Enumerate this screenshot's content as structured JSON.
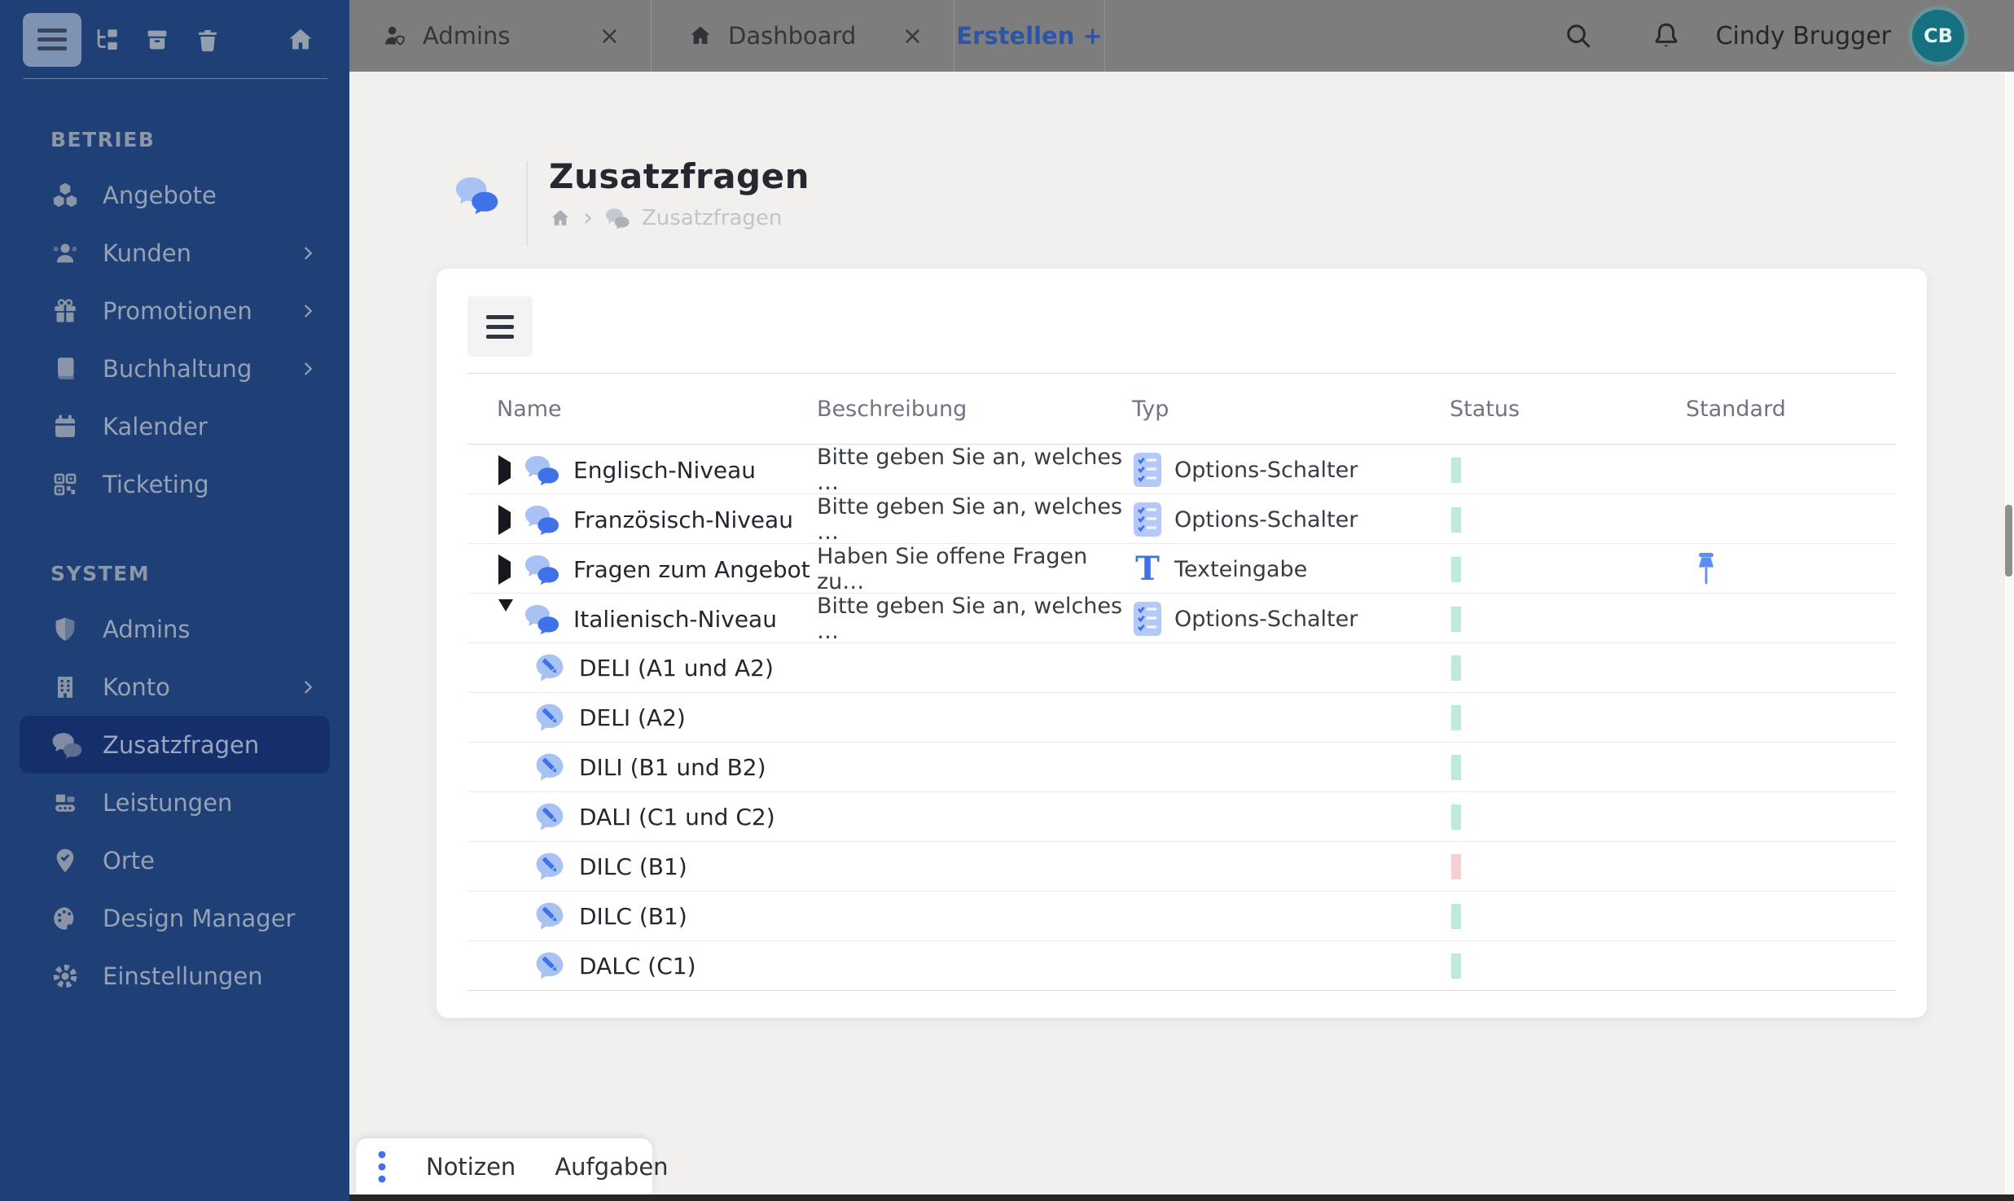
{
  "colors": {
    "sidebar_bg": "#1e4076",
    "sidebar_active_bg": "#152f6a",
    "topbar_bg": "#7d7d7d",
    "accent_blue": "#3f72e8",
    "light_blue": "#a9c2f4",
    "link_blue": "#2d55a5",
    "status_green": "#35bd8d",
    "status_red": "#e25f6a",
    "avatar_teal": "#15707f"
  },
  "sidebar": {
    "toolbar_icons": [
      "menu-icon",
      "tree-icon",
      "archive-icon",
      "trash-icon",
      "home-icon"
    ],
    "sections": [
      {
        "label": "BETRIEB",
        "items": [
          {
            "label": "Angebote",
            "icon": "cubes-icon",
            "chevron": false
          },
          {
            "label": "Kunden",
            "icon": "users-icon",
            "chevron": true
          },
          {
            "label": "Promotionen",
            "icon": "gift-icon",
            "chevron": true
          },
          {
            "label": "Buchhaltung",
            "icon": "book-icon",
            "chevron": true
          },
          {
            "label": "Kalender",
            "icon": "calendar-icon",
            "chevron": false
          },
          {
            "label": "Ticketing",
            "icon": "qr-code-icon",
            "chevron": false
          }
        ]
      },
      {
        "label": "SYSTEM",
        "items": [
          {
            "label": "Admins",
            "icon": "shield-icon",
            "chevron": false
          },
          {
            "label": "Konto",
            "icon": "building-icon",
            "chevron": true
          },
          {
            "label": "Zusatzfragen",
            "icon": "chat-bubbles-icon",
            "chevron": false,
            "active": true
          },
          {
            "label": "Leistungen",
            "icon": "services-icon",
            "chevron": false
          },
          {
            "label": "Orte",
            "icon": "map-pin-icon",
            "chevron": false
          },
          {
            "label": "Design Manager",
            "icon": "palette-icon",
            "chevron": false
          },
          {
            "label": "Einstellungen",
            "icon": "gear-icon",
            "chevron": false
          }
        ]
      }
    ]
  },
  "topbar": {
    "tabs": [
      {
        "label": "Admins",
        "icon": "user-icon",
        "close": "×"
      },
      {
        "label": "Dashboard",
        "icon": "home-icon",
        "close": "×"
      },
      {
        "label": "Erstellen +",
        "icon": null,
        "close": null
      }
    ],
    "user": {
      "name": "Cindy Brugger",
      "initials": "CB"
    }
  },
  "page": {
    "title": "Zusatzfragen",
    "breadcrumb": [
      "home",
      "Zusatzfragen"
    ]
  },
  "table": {
    "columns": [
      "Name",
      "Beschreibung",
      "Typ",
      "Status",
      "Standard"
    ],
    "rows": [
      {
        "name": "Englisch-Niveau",
        "description": "Bitte geben Sie an, welches …",
        "type": "Options-Schalter",
        "type_icon": "options-list-icon",
        "status": "green",
        "level": 0,
        "expanded": false,
        "pinned": false
      },
      {
        "name": "Französisch-Niveau",
        "description": "Bitte geben Sie an, welches …",
        "type": "Options-Schalter",
        "type_icon": "options-list-icon",
        "status": "green",
        "level": 0,
        "expanded": false,
        "pinned": false
      },
      {
        "name": "Fragen zum Angebot",
        "description": "Haben Sie offene Fragen zu…",
        "type": "Texteingabe",
        "type_icon": "text-input-icon",
        "status": "green",
        "level": 0,
        "expanded": false,
        "pinned": true
      },
      {
        "name": "Italienisch-Niveau",
        "description": "Bitte geben Sie an, welches …",
        "type": "Options-Schalter",
        "type_icon": "options-list-icon",
        "status": "green",
        "level": 0,
        "expanded": true,
        "pinned": false
      },
      {
        "name": "DELI (A1 und A2)",
        "description": "",
        "type": "",
        "type_icon": "pencil-bubble-icon",
        "status": "green",
        "level": 1,
        "pinned": false
      },
      {
        "name": "DELI (A2)",
        "description": "",
        "type": "",
        "type_icon": "pencil-bubble-icon",
        "status": "green",
        "level": 1,
        "pinned": false
      },
      {
        "name": "DILI (B1 und B2)",
        "description": "",
        "type": "",
        "type_icon": "pencil-bubble-icon",
        "status": "green",
        "level": 1,
        "pinned": false
      },
      {
        "name": "DALI (C1 und C2)",
        "description": "",
        "type": "",
        "type_icon": "pencil-bubble-icon",
        "status": "green",
        "level": 1,
        "pinned": false
      },
      {
        "name": "DILC (B1)",
        "description": "",
        "type": "",
        "type_icon": "pencil-bubble-icon",
        "status": "red",
        "level": 1,
        "pinned": false
      },
      {
        "name": "DILC (B1)",
        "description": "",
        "type": "",
        "type_icon": "pencil-bubble-icon",
        "status": "green",
        "level": 1,
        "pinned": false
      },
      {
        "name": "DALC (C1)",
        "description": "",
        "type": "",
        "type_icon": "pencil-bubble-icon",
        "status": "green",
        "level": 1,
        "pinned": false
      }
    ]
  },
  "notes_bar": {
    "items": [
      "Notizen",
      "Aufgaben"
    ]
  }
}
